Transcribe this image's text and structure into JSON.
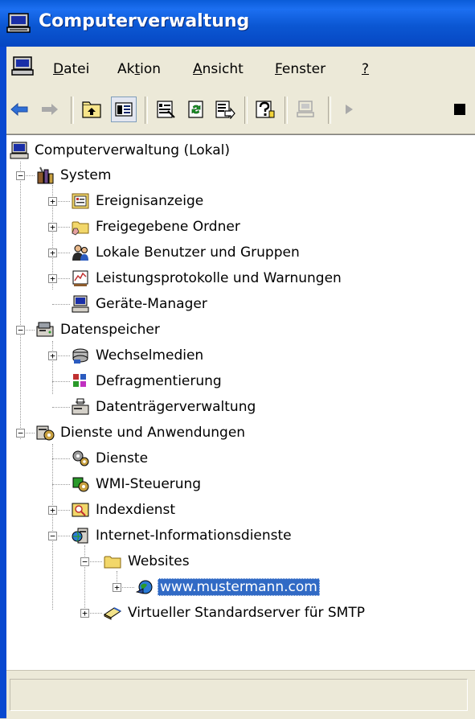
{
  "window": {
    "title": "Computerverwaltung"
  },
  "menubar": {
    "items": [
      {
        "label": "Datei",
        "accel": "D"
      },
      {
        "label": "Aktion",
        "accel": "t"
      },
      {
        "label": "Ansicht",
        "accel": "A"
      },
      {
        "label": "Fenster",
        "accel": "F"
      },
      {
        "label": "?",
        "accel": "?"
      }
    ]
  },
  "toolbar": {
    "buttons": [
      {
        "icon": "back-arrow-icon"
      },
      {
        "icon": "forward-arrow-icon"
      },
      {
        "icon": "up-level-icon"
      },
      {
        "icon": "show-hide-console-tree-icon",
        "pressed": true
      },
      {
        "icon": "properties-icon"
      },
      {
        "icon": "refresh-icon"
      },
      {
        "icon": "export-list-icon"
      },
      {
        "icon": "help-icon"
      },
      {
        "icon": "computer-disabled-icon"
      },
      {
        "icon": "play-icon"
      },
      {
        "icon": "stop-icon"
      }
    ]
  },
  "tree": {
    "root": "Computerverwaltung (Lokal)",
    "system": "System",
    "ereignisanzeige": "Ereignisanzeige",
    "freigegebene": "Freigegebene Ordner",
    "lokale": "Lokale Benutzer und Gruppen",
    "leistung": "Leistungsprotokolle und Warnungen",
    "geraete": "Geräte-Manager",
    "datenspeicher": "Datenspeicher",
    "wechsel": "Wechselmedien",
    "defrag": "Defragmentierung",
    "datentraeger": "Datenträgerverwaltung",
    "dienste_anw": "Dienste und Anwendungen",
    "dienste": "Dienste",
    "wmi": "WMI-Steuerung",
    "index": "Indexdienst",
    "iis": "Internet-Informationsdienste",
    "websites": "Websites",
    "site": "www.mustermann.com",
    "smtp": "Virtueller Standardserver für SMTP"
  },
  "colors": {
    "selection": "#316ac5",
    "titlebar": "#0a5cd8"
  }
}
